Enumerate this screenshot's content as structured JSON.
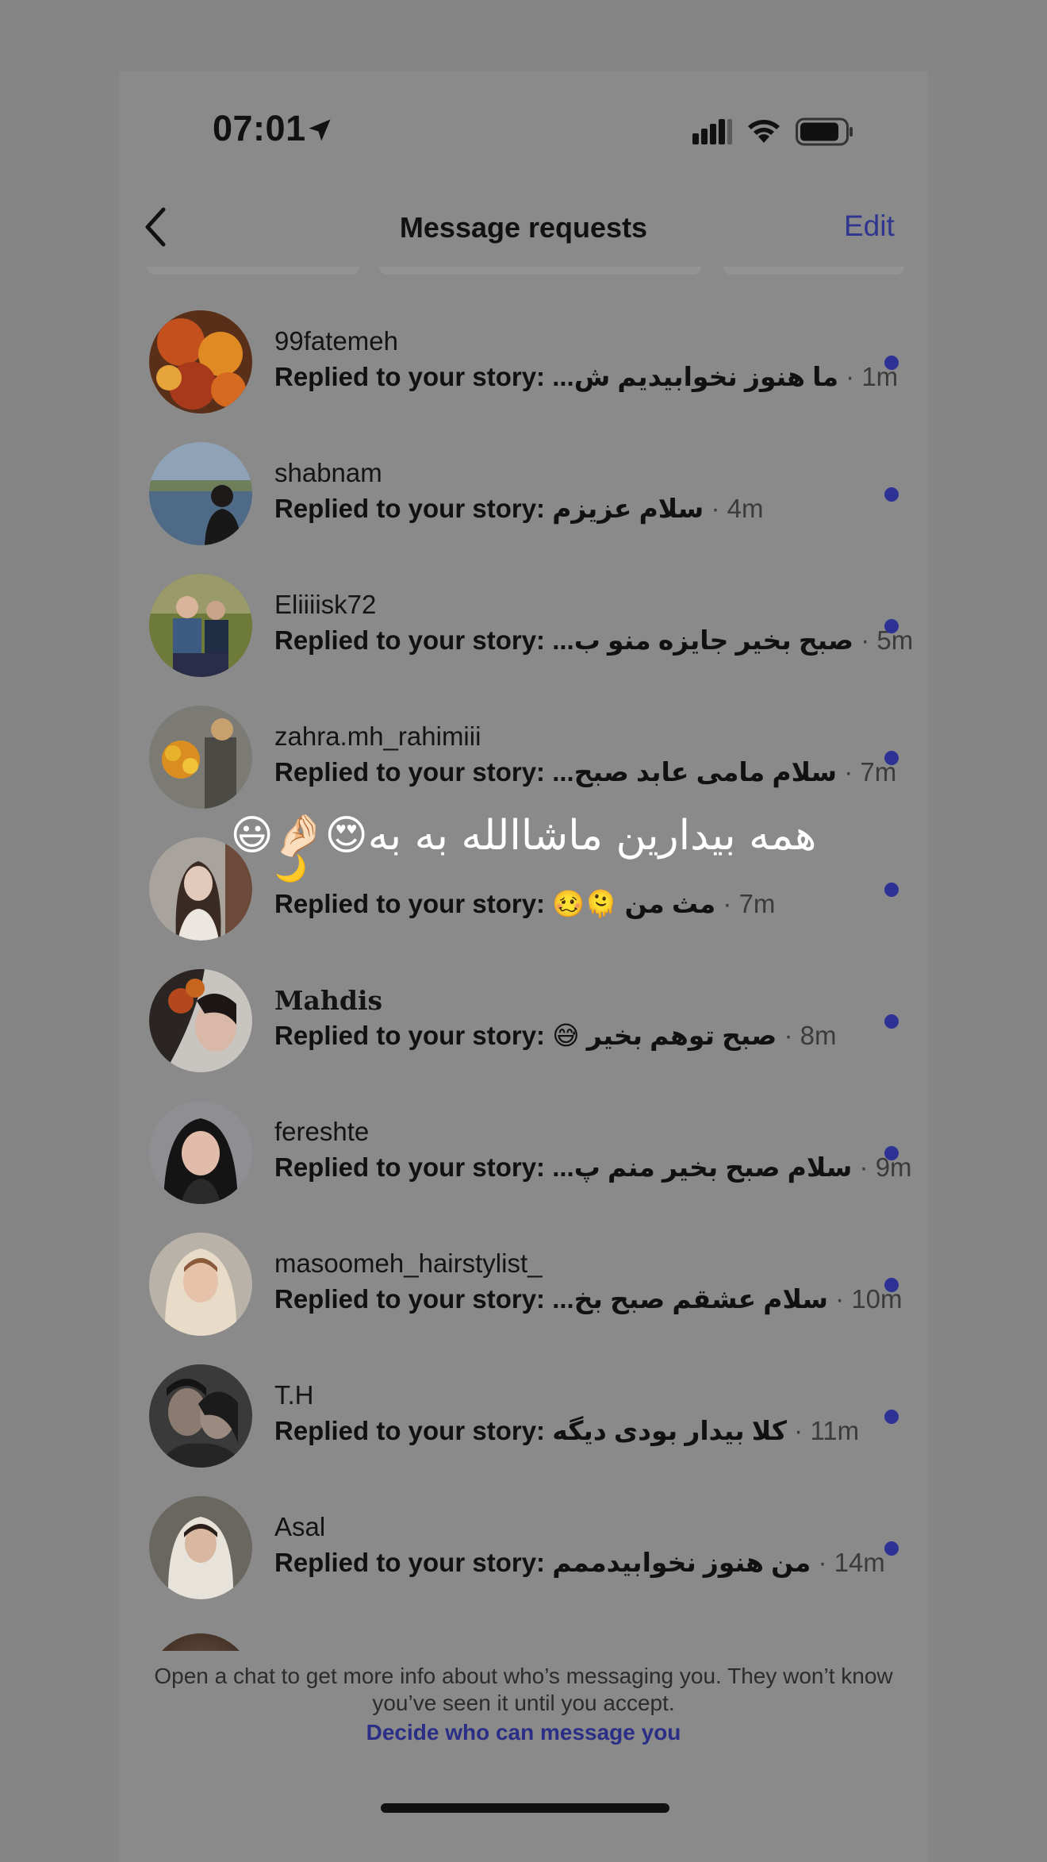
{
  "status_bar": {
    "time": "07:01"
  },
  "header": {
    "title": "Message requests",
    "edit_label": "Edit"
  },
  "requests": [
    {
      "username": "99fatemeh",
      "prefix": "Replied to your story:",
      "message": "ما هنوز نخوابیدیم ش...",
      "time": "· 1m"
    },
    {
      "username": "shabnam",
      "prefix": "Replied to your story:",
      "message": "سلام عزیزم",
      "time": "· 4m"
    },
    {
      "username": "Eliiiisk72",
      "prefix": "Replied to your story:",
      "message": "صبح بخیر جایزه منو ب...",
      "time": "· 5m"
    },
    {
      "username": "zahra.mh_rahimiii",
      "prefix": "Replied to your story:",
      "message": "سلام مامی عابد صبح...",
      "time": "· 7m"
    },
    {
      "username": "🌙",
      "prefix": "Replied to your story:",
      "message": "مث من 🫠🥴",
      "time": "· 7m"
    },
    {
      "username": "Mahdis",
      "prefix": "Replied to your story:",
      "message": "صبح توهم بخیر 😅",
      "time": "· 8m"
    },
    {
      "username": "fereshte",
      "prefix": "Replied to your story:",
      "message": "سلام صبح بخیر منم پ...",
      "time": "· 9m"
    },
    {
      "username": "masoomeh_hairstylist_",
      "prefix": "Replied to your story:",
      "message": "سلام عشقم صبح بخ...",
      "time": "· 10m"
    },
    {
      "username": "T.H",
      "prefix": "Replied to your story:",
      "message": "کلا بیدار بودی دیگه",
      "time": "· 11m"
    },
    {
      "username": "Asal",
      "prefix": "Replied to your story:",
      "message": "من هنوز نخوابیدممم",
      "time": "· 14m"
    }
  ],
  "overlay": {
    "text": "همه بیدارین ماشاالله به به😍🤌🏻😃"
  },
  "footer": {
    "text": "Open a chat to get more info about who’s messaging you. They won’t know you’ve seen it until you accept.",
    "link": "Decide who can message you"
  },
  "colors": {
    "accent": "#2f3590",
    "unread_dot": "#2c3193",
    "background": "#858585"
  },
  "icons": {
    "back": "chevron-left-icon",
    "location": "location-arrow-icon",
    "signal": "signal-icon",
    "wifi": "wifi-icon",
    "battery": "battery-icon"
  }
}
